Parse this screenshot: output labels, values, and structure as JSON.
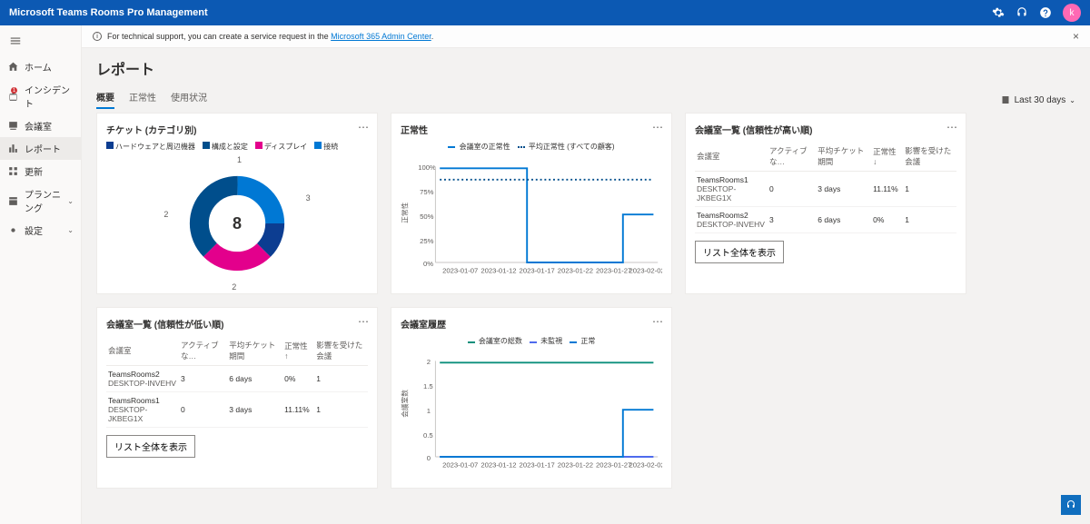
{
  "topbar": {
    "title": "Microsoft Teams Rooms Pro Management",
    "avatar_initial": "k"
  },
  "sidebar": {
    "items": [
      {
        "label": "ホーム"
      },
      {
        "label": "インシデント",
        "badge": 1
      },
      {
        "label": "会議室"
      },
      {
        "label": "レポート",
        "selected": true
      },
      {
        "label": "更新"
      },
      {
        "label": "プランニング",
        "chevron": true
      },
      {
        "label": "設定",
        "chevron": true
      }
    ]
  },
  "banner": {
    "prefix": "For technical support, you can create a service request in the ",
    "link": "Microsoft 365 Admin Center",
    "suffix": "."
  },
  "page": {
    "title": "レポート",
    "tabs": [
      "概要",
      "正常性",
      "使用状況"
    ],
    "active_tab": 0,
    "date_label": "Last 30 days"
  },
  "cards": {
    "tickets_by_category": {
      "title": "チケット (カテゴリ別)",
      "legend": [
        "ハードウェアと周辺機器",
        "構成と設定",
        "ディスプレイ",
        "接続"
      ],
      "center_value": "8",
      "labels": {
        "l1": "1",
        "l2": "2",
        "l3": "3",
        "l4": "2"
      }
    },
    "health": {
      "title": "正常性",
      "legend": [
        "会議室の正常性",
        "平均正常性 (すべての顧客)"
      ],
      "y_axis_label": "正常性"
    },
    "rooms_high": {
      "title": "会議室一覧 (信頼性が高い順)",
      "headers": [
        "会議室",
        "アクティブな…",
        "平均チケット期間",
        "正常性 ↓",
        "影響を受けた会議"
      ],
      "rows": [
        {
          "name": "TeamsRooms1",
          "sub": "DESKTOP-JKBEG1X",
          "active": "0",
          "dur": "3 days",
          "health": "11.11%",
          "affected": "1"
        },
        {
          "name": "TeamsRooms2",
          "sub": "DESKTOP-INVEHV",
          "active": "3",
          "dur": "6 days",
          "health": "0%",
          "affected": "1"
        }
      ],
      "button": "リスト全体を表示"
    },
    "rooms_low": {
      "title": "会議室一覧 (信頼性が低い順)",
      "headers": [
        "会議室",
        "アクティブな…",
        "平均チケット期間",
        "正常性 ↑",
        "影響を受けた会議"
      ],
      "rows": [
        {
          "name": "TeamsRooms2",
          "sub": "DESKTOP-INVEHV",
          "active": "3",
          "dur": "6 days",
          "health": "0%",
          "affected": "1"
        },
        {
          "name": "TeamsRooms1",
          "sub": "DESKTOP-JKBEG1X",
          "active": "0",
          "dur": "3 days",
          "health": "11.11%",
          "affected": "1"
        }
      ],
      "button": "リスト全体を表示"
    },
    "room_history": {
      "title": "会議室履歴",
      "legend": [
        "会議室の総数",
        "未監視",
        "正常"
      ],
      "y_axis_label": "会議室数"
    }
  },
  "chart_data": [
    {
      "type": "pie",
      "title": "チケット (カテゴリ別)",
      "series": [
        {
          "name": "ハードウェアと周辺機器",
          "value": 1,
          "color": "#0c3d91"
        },
        {
          "name": "構成と設定",
          "value": 2,
          "color": "#004e8c"
        },
        {
          "name": "ディスプレイ",
          "value": 3,
          "color": "#e3008c"
        },
        {
          "name": "接続",
          "value": 2,
          "color": "#0078d4"
        }
      ],
      "total": 8
    },
    {
      "type": "line",
      "title": "正常性",
      "x": [
        "2023-01-07",
        "2023-01-12",
        "2023-01-17",
        "2023-01-22",
        "2023-01-27",
        "2023-02-02"
      ],
      "series": [
        {
          "name": "会議室の正常性",
          "values": [
            100,
            100,
            100,
            0,
            0,
            50
          ],
          "color": "#0078d4"
        },
        {
          "name": "平均正常性 (すべての顧客)",
          "values": [
            88,
            88,
            88,
            88,
            88,
            88
          ],
          "color": "#004e8c",
          "dashed": true
        }
      ],
      "ylabel": "正常性",
      "ylim": [
        0,
        100
      ],
      "yticks": [
        0,
        25,
        50,
        75,
        100
      ]
    },
    {
      "type": "line",
      "title": "会議室履歴",
      "x": [
        "2023-01-07",
        "2023-01-12",
        "2023-01-17",
        "2023-01-22",
        "2023-01-27",
        "2023-02-02"
      ],
      "series": [
        {
          "name": "会議室の総数",
          "values": [
            2,
            2,
            2,
            2,
            2,
            2
          ],
          "color": "#0c8f7c"
        },
        {
          "name": "未監視",
          "values": [
            0,
            0,
            0,
            0,
            0,
            0
          ],
          "color": "#4f6bed"
        },
        {
          "name": "正常",
          "values": [
            0,
            0,
            0,
            0,
            0,
            1
          ],
          "color": "#0078d4"
        }
      ],
      "ylabel": "会議室数",
      "ylim": [
        0,
        2
      ],
      "yticks": [
        0,
        0.5,
        1,
        1.5,
        2
      ]
    }
  ]
}
